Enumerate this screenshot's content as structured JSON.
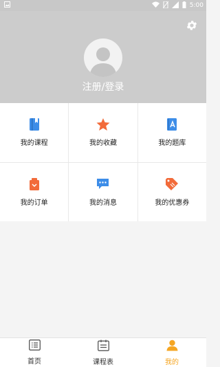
{
  "status_bar": {
    "time": "5:00",
    "icons": [
      "image-notification-icon",
      "wifi-icon",
      "no-sim-icon",
      "signal-icon",
      "battery-icon"
    ]
  },
  "header": {
    "login_label": "注册/登录",
    "settings_icon": "gear-icon",
    "avatar_icon": "default-avatar-icon"
  },
  "grid": {
    "items": [
      {
        "label": "我的课程",
        "icon": "course-book-icon",
        "color": "#3d8de8"
      },
      {
        "label": "我的收藏",
        "icon": "star-icon",
        "color": "#f26b3a"
      },
      {
        "label": "我的题库",
        "icon": "question-bank-icon",
        "color": "#3d8de8"
      },
      {
        "label": "我的订单",
        "icon": "order-bag-icon",
        "color": "#f26b3a"
      },
      {
        "label": "我的消息",
        "icon": "message-icon",
        "color": "#3d8de8"
      },
      {
        "label": "我的优惠券",
        "icon": "coupon-icon",
        "color": "#f26b3a"
      }
    ]
  },
  "bottom_nav": {
    "items": [
      {
        "label": "首页",
        "icon": "home-list-icon",
        "active": false
      },
      {
        "label": "课程表",
        "icon": "schedule-icon",
        "active": false
      },
      {
        "label": "我的",
        "icon": "profile-icon",
        "active": true
      }
    ],
    "active_color": "#f5a623"
  }
}
